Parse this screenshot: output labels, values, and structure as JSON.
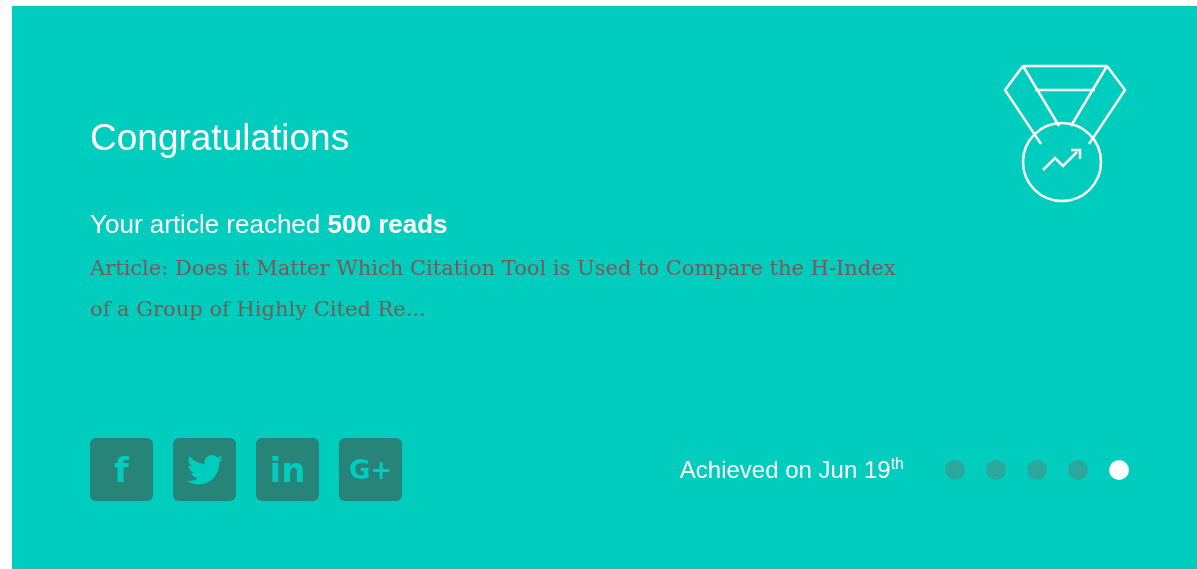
{
  "card": {
    "title": "Congratulations",
    "message": "Your article reached **500 reads**",
    "article": "Article: Does it Matter Which Citation Tool is Used to Compare the H-Index of a Group of Highly Cited Re...",
    "share_buttons": [
      {
        "kind": "facebook",
        "glyph": "f"
      },
      {
        "kind": "twitter"
      },
      {
        "kind": "linkedin",
        "glyph": "in"
      },
      {
        "kind": "googleplus",
        "glyph": "G+"
      }
    ],
    "achieved": "Achieved on Jun 19$^{th}$",
    "pager": [
      {
        "selected": false
      },
      {
        "selected": false
      },
      {
        "selected": false
      },
      {
        "selected": false
      },
      {
        "selected": true
      }
    ]
  }
}
